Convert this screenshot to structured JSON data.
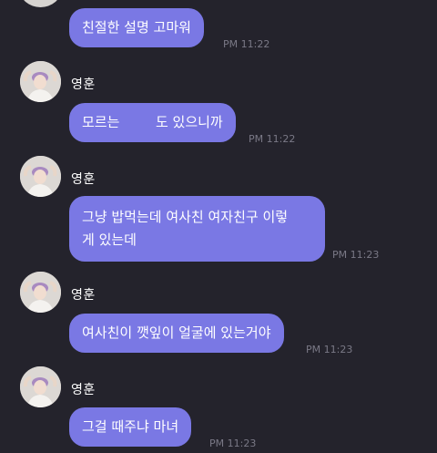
{
  "colors": {
    "background": "#24232c",
    "bubble": "#7a78e4",
    "text": "#ffffff",
    "timestamp": "#7a7986"
  },
  "avatar_icon": "profile-photo",
  "messages": [
    {
      "sender": "",
      "text": "친절한 설명 고마워",
      "time": "PM 11:22"
    },
    {
      "sender": "영훈",
      "text_before": "모르는",
      "text_after": "도 있으니까",
      "time": "PM 11:22"
    },
    {
      "sender": "영훈",
      "line1": "그냥 밥먹는데 여사친 여자친구 이렇",
      "line2": "게 있는데",
      "time": "PM 11:23"
    },
    {
      "sender": "영훈",
      "text": "여사친이 깻잎이 얼굴에 있는거야",
      "time": "PM 11:23"
    },
    {
      "sender": "영훈",
      "text": "그걸 때주냐 마녀",
      "time": "PM 11:23"
    }
  ]
}
